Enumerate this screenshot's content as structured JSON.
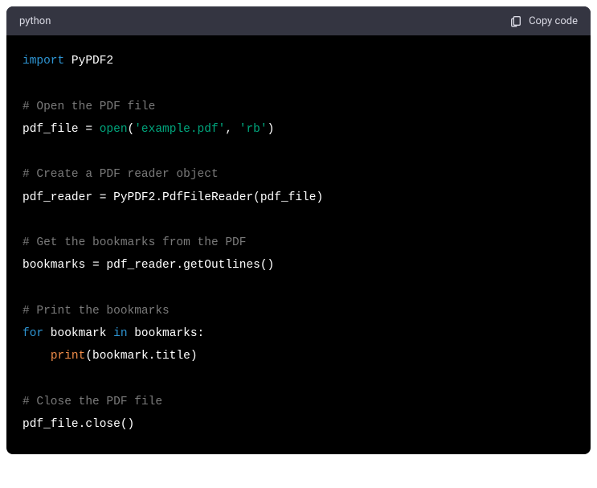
{
  "header": {
    "language": "python",
    "copy_label": "Copy code"
  },
  "code": {
    "kw_import": "import",
    "module": " PyPDF2",
    "c1": "# Open the PDF file",
    "l2a": "pdf_file = ",
    "l2b": "open",
    "l2c": "(",
    "l2d": "'example.pdf'",
    "l2e": ", ",
    "l2f": "'rb'",
    "l2g": ")",
    "c2": "# Create a PDF reader object",
    "l3": "pdf_reader = PyPDF2.PdfFileReader(pdf_file)",
    "c3": "# Get the bookmarks from the PDF",
    "l4": "bookmarks = pdf_reader.getOutlines()",
    "c4": "# Print the bookmarks",
    "l5a": "for",
    "l5b": " bookmark ",
    "l5c": "in",
    "l5d": " bookmarks:",
    "l6a": "    ",
    "l6b": "print",
    "l6c": "(bookmark.title)",
    "c5": "# Close the PDF file",
    "l7": "pdf_file.close()"
  }
}
